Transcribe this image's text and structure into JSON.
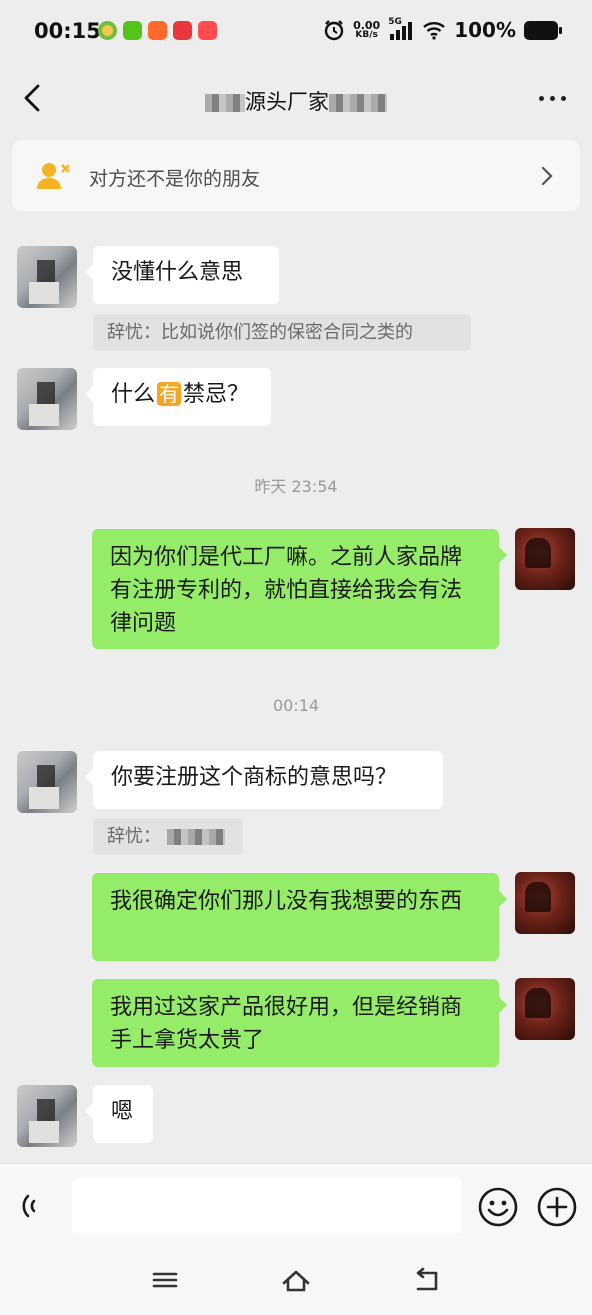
{
  "status_bar": {
    "time": "00:15",
    "net_speed_value": "0.00",
    "net_speed_unit": "KB/s",
    "network": "5G",
    "battery": "100%",
    "app_icons": [
      "app-icon-green",
      "app-icon-green-check",
      "app-icon-orange",
      "app-icon-red-heart",
      "app-icon-red"
    ]
  },
  "header": {
    "title": "源头厂家"
  },
  "banner": {
    "text": "对方还不是你的朋友"
  },
  "messages": {
    "m1": "没懂什么意思",
    "q1": "辞忧：比如说你们签的保密合同之类的",
    "m2_pre": "什么",
    "m2_badge": "有",
    "m2_post": "禁忌？",
    "ts1": "昨天 23:54",
    "m3": "因为你们是代工厂嘛。之前人家品牌有注册专利的，就怕直接给我会有法律问题",
    "ts2": "00:14",
    "m4": "你要注册这个商标的意思吗？",
    "q2": "辞忧：",
    "m5": "我很确定你们那儿没有我想要的东西",
    "m6": "我用过这家产品很好用，但是经销商手上拿货太贵了",
    "m7": "嗯"
  },
  "colors": {
    "bg": "#ededed",
    "sent_bubble": "#95ec69",
    "received_bubble": "#ffffff",
    "you_badge": "#f5a524"
  }
}
